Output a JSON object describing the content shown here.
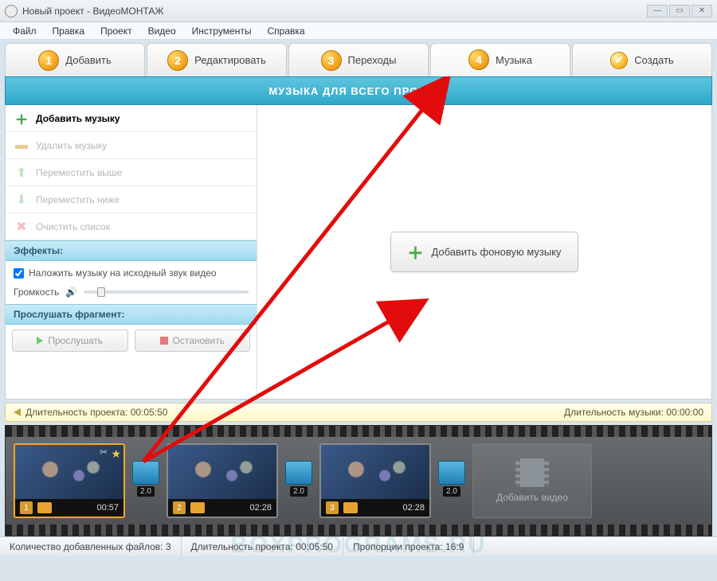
{
  "window": {
    "title": "Новый проект - ВидеоМОНТАЖ"
  },
  "menu": {
    "file": "Файл",
    "edit": "Правка",
    "project": "Проект",
    "video": "Видео",
    "tools": "Инструменты",
    "help": "Справка"
  },
  "tabs": {
    "add": "Добавить",
    "edit": "Редактировать",
    "transitions": "Переходы",
    "music": "Музыка",
    "create": "Создать"
  },
  "banner": "МУЗЫКА ДЛЯ ВСЕГО ПРОЕКТА",
  "sidebar": {
    "add_music": "Добавить музыку",
    "delete_music": "Удалить музыку",
    "move_up": "Переместить выше",
    "move_down": "Переместить ниже",
    "clear_list": "Очистить список",
    "effects_head": "Эффекты:",
    "overlay_label": "Наложить музыку на исходный звук видео",
    "volume_label": "Громкость",
    "preview_head": "Прослушать фрагмент:",
    "play": "Прослушать",
    "stop": "Остановить"
  },
  "main_button": "Добавить фоновую музыку",
  "duration": {
    "project_label": "Длительность проекта:",
    "project_value": "00:05:50",
    "music_label": "Длительность музыки:",
    "music_value": "00:00:00"
  },
  "timeline": {
    "clips": [
      {
        "index": "1",
        "time": "00:57",
        "selected": true,
        "star": true,
        "scissors": true
      },
      {
        "index": "2",
        "time": "02:28",
        "selected": false
      },
      {
        "index": "3",
        "time": "02:28",
        "selected": false
      }
    ],
    "transition_label": "2.0",
    "add_video": "Добавить видео"
  },
  "status": {
    "files_label": "Количество добавленных файлов:",
    "files_value": "3",
    "duration_label": "Длительность проекта:",
    "duration_value": "00:05:50",
    "aspect_label": "Пропорции проекта:",
    "aspect_value": "16:9"
  },
  "watermark": "BOXPROGRAMS.RU"
}
